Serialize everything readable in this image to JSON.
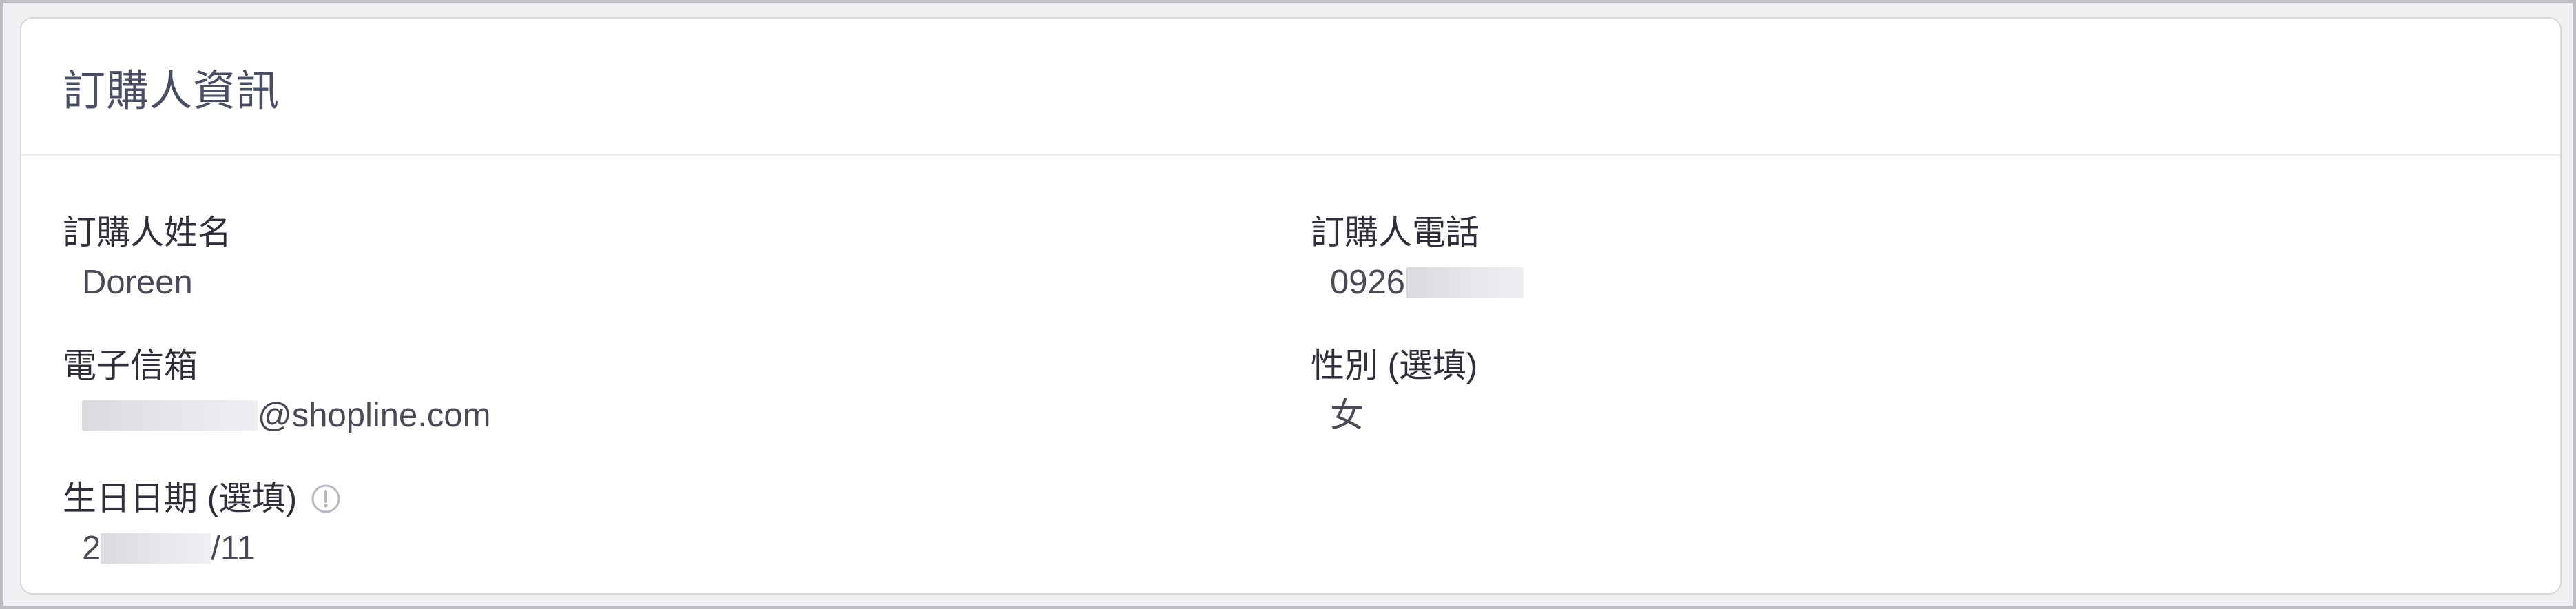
{
  "card": {
    "title": "訂購人資訊"
  },
  "fields": {
    "name": {
      "label": "訂購人姓名",
      "value": "Doreen"
    },
    "phone": {
      "label": "訂購人電話",
      "value_prefix": "0926"
    },
    "email": {
      "label": "電子信箱",
      "value_suffix": "@shopline.com"
    },
    "gender": {
      "label": "性別 (選填)",
      "value": "女"
    },
    "birthday": {
      "label": "生日日期 (選填)",
      "value_prefix": "2",
      "value_suffix": "/11",
      "info_icon": "info-circle-icon"
    }
  },
  "colors": {
    "title_text": "#4a4e63",
    "label_text": "#2f2f3a",
    "value_text": "#4a4a55",
    "redaction": "#dedee2",
    "card_border": "#d8d8de"
  }
}
